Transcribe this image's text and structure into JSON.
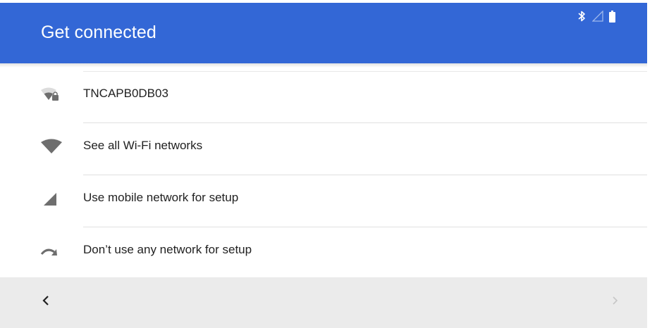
{
  "app_bar": {
    "title": "Get connected",
    "color": "#3367d6"
  },
  "status_bar": {
    "icons": [
      "bluetooth-icon",
      "cell-signal-icon",
      "battery-icon"
    ]
  },
  "networks": [
    {
      "label": "TNCAPB0DB03",
      "icon": "wifi-locked-icon"
    },
    {
      "label": "See all Wi-Fi networks",
      "icon": "wifi-icon"
    },
    {
      "label": "Use mobile network for setup",
      "icon": "cell-signal-icon"
    },
    {
      "label": "Don’t use any network for setup",
      "icon": "skip-arrow-icon"
    }
  ],
  "nav_bar": {
    "back_icon": "chevron-left-icon",
    "next_icon": "chevron-right-icon",
    "next_enabled": false
  }
}
